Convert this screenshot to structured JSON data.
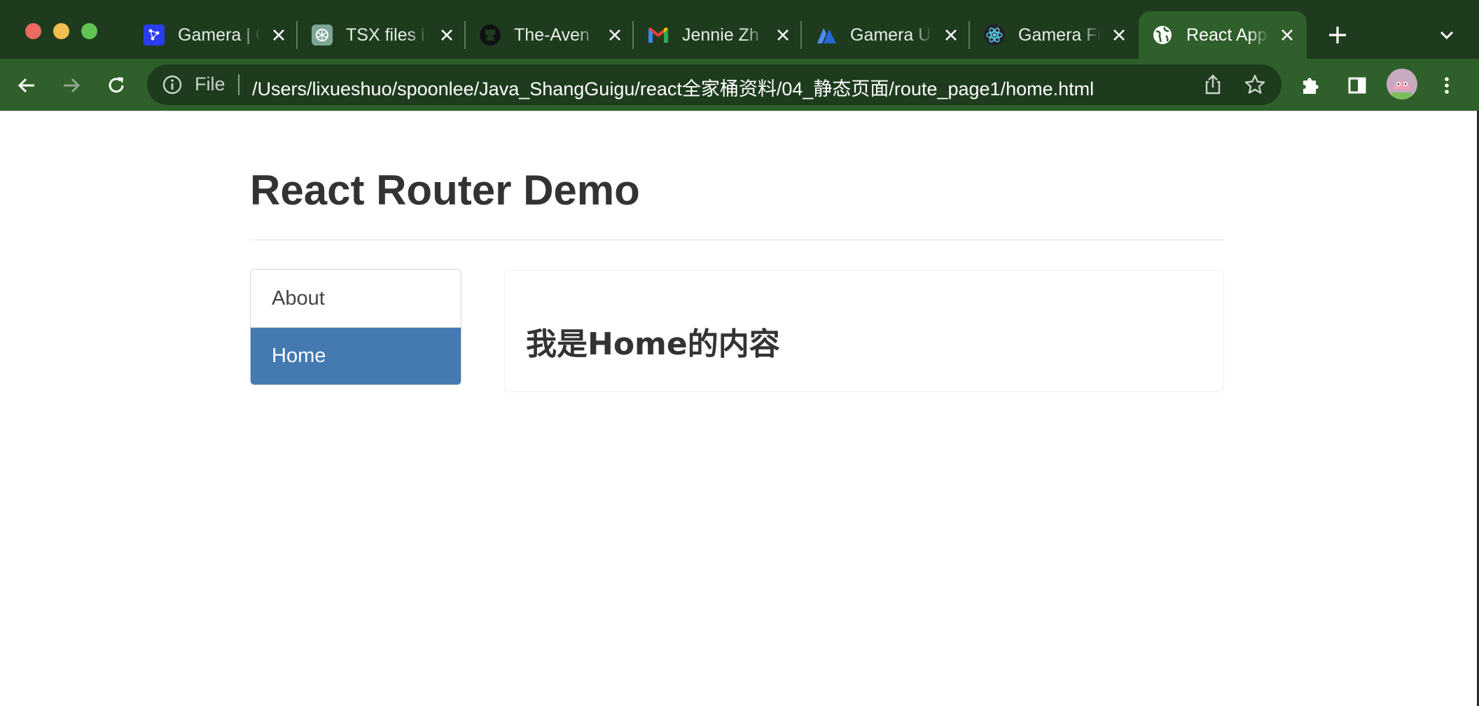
{
  "browser": {
    "tabs": [
      {
        "title": "Gamera | C",
        "favicon": "gamera-network-icon",
        "active": false
      },
      {
        "title": "TSX files i",
        "favicon": "openai-icon",
        "active": false
      },
      {
        "title": "The-Aven",
        "favicon": "github-icon",
        "active": false
      },
      {
        "title": "Jennie Zh",
        "favicon": "gmail-icon",
        "active": false
      },
      {
        "title": "Gamera U",
        "favicon": "atlassian-icon",
        "active": false
      },
      {
        "title": "Gamera Fr",
        "favicon": "react-icon",
        "active": false
      },
      {
        "title": "React App",
        "favicon": "globe-icon",
        "active": true
      }
    ],
    "omnibox": {
      "scheme_label": "File",
      "url": "/Users/lixueshuo/spoonlee/Java_ShangGuigu/react全家桶资料/04_静态页面/route_page1/home.html"
    },
    "colors": {
      "frame": "#1e3b1e",
      "toolbar": "#2f5f2a"
    }
  },
  "page": {
    "title": "React Router Demo",
    "nav": [
      {
        "label": "About",
        "active": false
      },
      {
        "label": "Home",
        "active": true
      }
    ],
    "content_heading": "我是Home的内容",
    "colors": {
      "active_nav": "#4479b2",
      "text": "#333333"
    }
  }
}
